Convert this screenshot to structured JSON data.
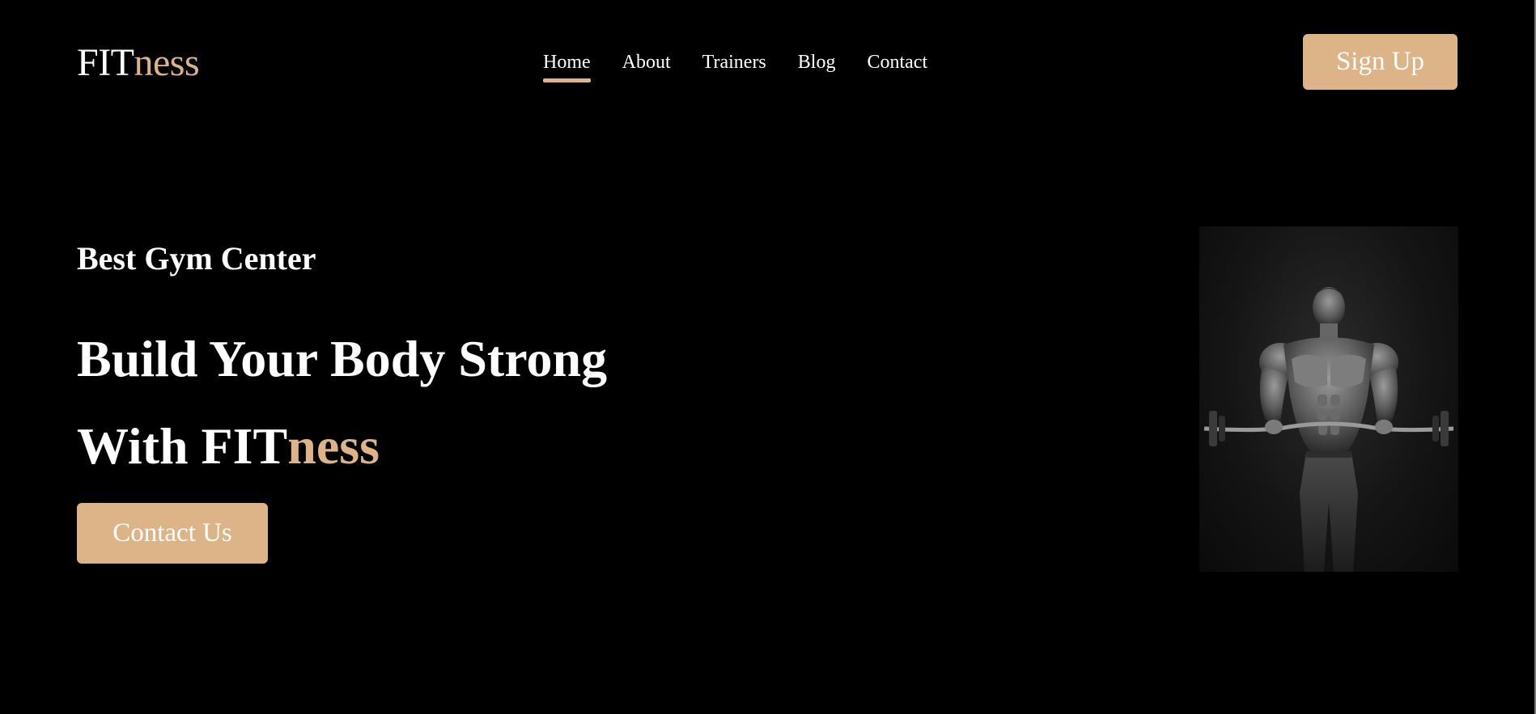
{
  "header": {
    "logo": {
      "part1": "FIT",
      "part2": "ness"
    },
    "nav": [
      {
        "label": "Home",
        "active": true
      },
      {
        "label": "About",
        "active": false
      },
      {
        "label": "Trainers",
        "active": false
      },
      {
        "label": "Blog",
        "active": false
      },
      {
        "label": "Contact",
        "active": false
      }
    ],
    "signup_label": "Sign Up"
  },
  "hero": {
    "kicker": "Best Gym Center",
    "title_line1": "Build Your Body Strong",
    "title_line2_prefix": "With ",
    "title_line2_part1": "FIT",
    "title_line2_part2": "ness",
    "cta_label": "Contact Us",
    "image_icon": "bodybuilder-photo"
  },
  "colors": {
    "background": "#000000",
    "accent": "#dcb487",
    "text": "#ffffff"
  }
}
